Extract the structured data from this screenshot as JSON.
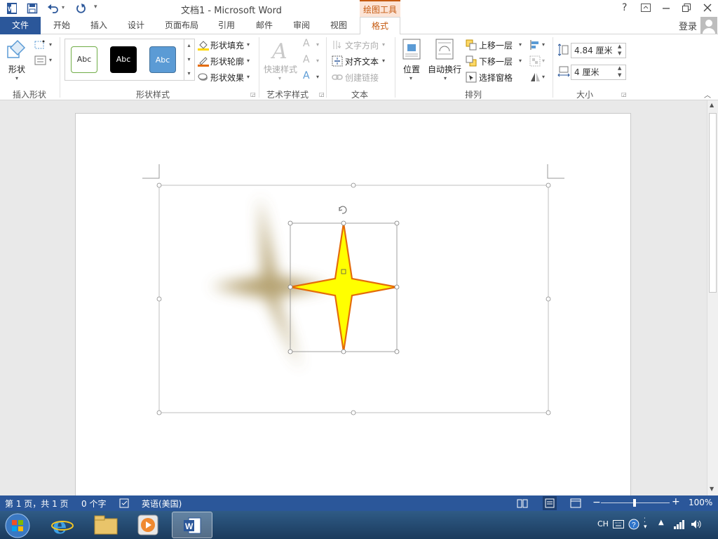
{
  "window": {
    "title": "文档1 - Microsoft Word",
    "contextual_tab_group": "绘图工具",
    "help": "?",
    "signin": "登录"
  },
  "tabs": [
    "文件",
    "开始",
    "插入",
    "设计",
    "页面布局",
    "引用",
    "邮件",
    "审阅",
    "视图",
    "格式"
  ],
  "active_tab": "格式",
  "ribbon": {
    "insert_shapes": {
      "shapes_label": "形状",
      "group_label": "插入形状"
    },
    "shape_styles": {
      "style_samples": [
        "Abc",
        "Abc",
        "Abc"
      ],
      "fill": "形状填充",
      "outline": "形状轮廓",
      "effects": "形状效果",
      "group_label": "形状样式"
    },
    "wordart": {
      "quick_styles": "快速样式",
      "group_label": "艺术字样式"
    },
    "text": {
      "direction": "文字方向",
      "align": "对齐文本",
      "link": "创建链接",
      "group_label": "文本"
    },
    "arrange": {
      "position": "位置",
      "wrap": "自动换行",
      "bring_forward": "上移一层",
      "send_backward": "下移一层",
      "selection_pane": "选择窗格",
      "group_label": "排列"
    },
    "size": {
      "height": "4.84 厘米",
      "width": "4 厘米",
      "group_label": "大小"
    }
  },
  "statusbar": {
    "page": "第 1 页，共 1 页",
    "words": "0 个字",
    "language": "英语(美国)",
    "zoom": "100%"
  },
  "taskbar": {
    "ime": "CH"
  },
  "colors": {
    "accent": "#2b579a",
    "contextual": "#c55a11",
    "star_fill": "#ffff00",
    "star_outline": "#e46c0a",
    "shadow": "#a9935a"
  }
}
